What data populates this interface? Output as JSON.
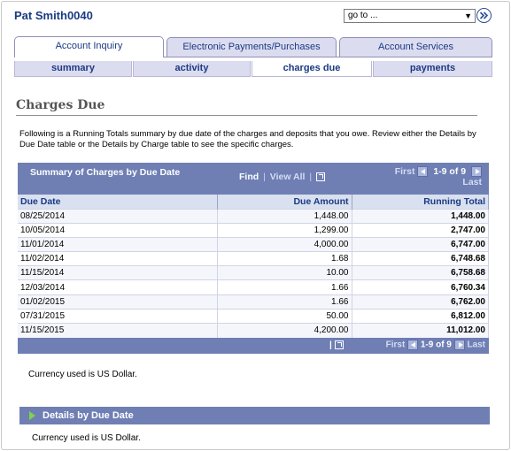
{
  "header": {
    "user_name": "Pat Smith0040",
    "goto_value": "go to ..."
  },
  "tabs": [
    {
      "label": "Account Inquiry",
      "active": true
    },
    {
      "label": "Electronic Payments/Purchases",
      "active": false
    },
    {
      "label": "Account Services",
      "active": false
    }
  ],
  "subtabs": [
    {
      "label": "summary",
      "active": false
    },
    {
      "label": "activity",
      "active": false
    },
    {
      "label": "charges due",
      "active": true
    },
    {
      "label": "payments",
      "active": false
    }
  ],
  "page": {
    "title": "Charges Due",
    "intro": "Following is a Running Totals summary by due date of the charges and deposits that you owe.  Review either the Details by Due Date table or the Details by Charge table to see the specific charges."
  },
  "grid": {
    "title": "Summary of Charges by Due Date",
    "find": "Find",
    "separator": "|",
    "view_all": "View All",
    "first": "First",
    "count": "1-9 of 9",
    "last": "Last",
    "columns": [
      "Due Date",
      "Due Amount",
      "Running Total"
    ],
    "rows": [
      [
        "08/25/2014",
        "1,448.00",
        "1,448.00"
      ],
      [
        "10/05/2014",
        "1,299.00",
        "2,747.00"
      ],
      [
        "11/01/2014",
        "4,000.00",
        "6,747.00"
      ],
      [
        "11/02/2014",
        "1.68",
        "6,748.68"
      ],
      [
        "11/15/2014",
        "10.00",
        "6,758.68"
      ],
      [
        "12/03/2014",
        "1.66",
        "6,760.34"
      ],
      [
        "01/02/2015",
        "1.66",
        "6,762.00"
      ],
      [
        "07/31/2015",
        "50.00",
        "6,812.00"
      ],
      [
        "11/15/2015",
        "4,200.00",
        "11,012.00"
      ]
    ]
  },
  "currency_note_1": "Currency used is US Dollar.",
  "details_section": {
    "title": "Details by Due Date"
  },
  "currency_note_2": "Currency used is US Dollar.",
  "colors": {
    "brand_blue": "#1a3a82",
    "grid_header": "#6f7fb4",
    "tab_bg": "#dcdcf0",
    "expand_arrow": "#7bd44a"
  }
}
